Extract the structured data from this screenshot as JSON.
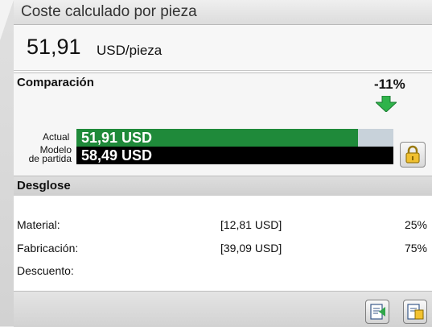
{
  "window": {
    "title": "Coste calculado por pieza"
  },
  "cost": {
    "value": "51,91",
    "unit": "USD/pieza"
  },
  "comparison": {
    "label": "Comparación",
    "percent": "-11%",
    "actual_label": "Actual",
    "actual_value": "51,91 USD",
    "actual_fraction": 0.8876,
    "model_label_line1": "Modelo",
    "model_label_line2": "de partida",
    "model_value": "58,49 USD",
    "model_fraction": 1.0
  },
  "breakdown": {
    "label": "Desglose",
    "rows": [
      {
        "name": "Material:",
        "value": "[12,81 USD]",
        "percent": "25%"
      },
      {
        "name": "Fabricación:",
        "value": "[39,09 USD]",
        "percent": "75%"
      },
      {
        "name": "Descuento:",
        "value": "",
        "percent": ""
      }
    ]
  },
  "colors": {
    "actual_bar": "#1f8a3a",
    "model_bar": "#000000",
    "down_arrow": "#2fb34a"
  },
  "icons": [
    "lock-icon",
    "down-arrow-icon",
    "export-report-icon",
    "settings-report-icon"
  ]
}
